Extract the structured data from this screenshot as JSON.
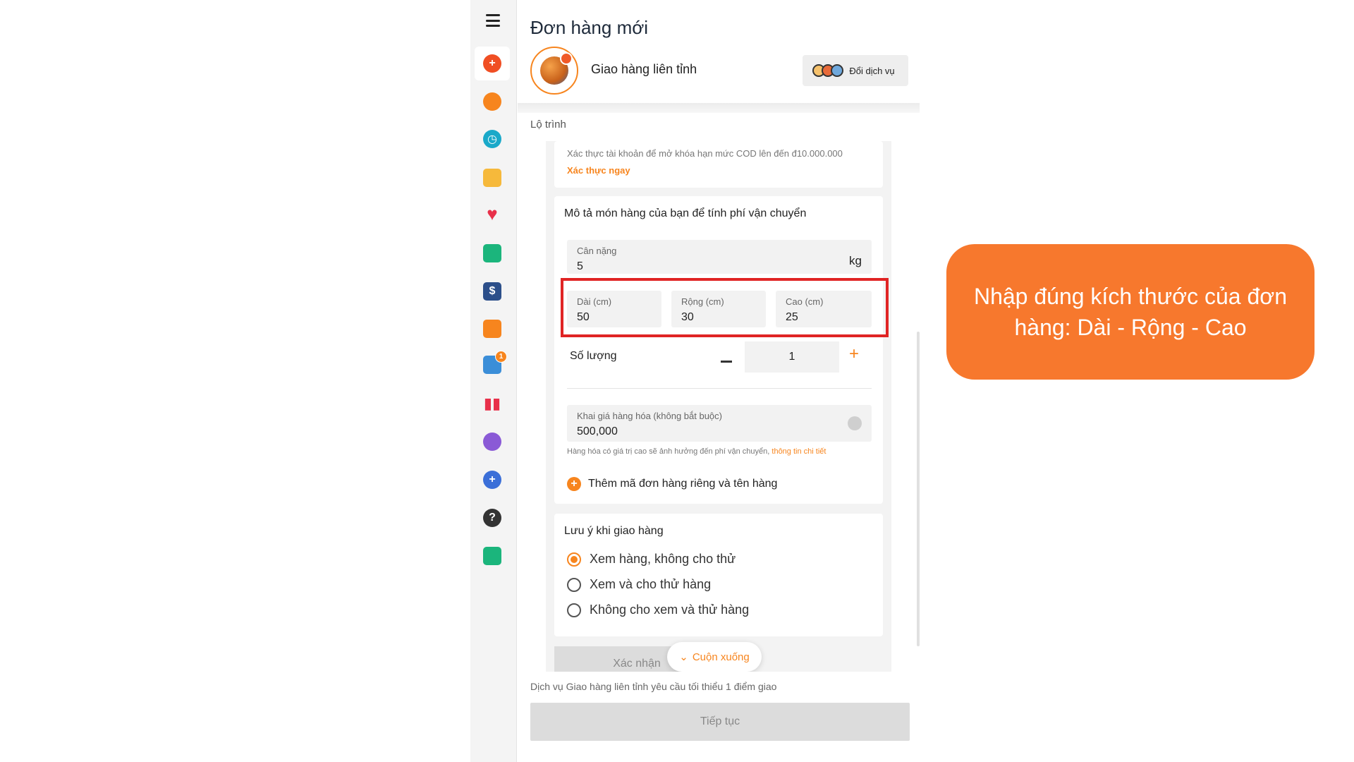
{
  "page": {
    "title": "Đơn hàng mới",
    "service_name": "Giao hàng liên tỉnh",
    "switch_service_label": "Đổi dịch vụ",
    "route_label": "Lộ trình"
  },
  "sidebar": {
    "items": [
      {
        "icon": "add-order-icon",
        "color": "#f04e23"
      },
      {
        "icon": "delivery-icon",
        "color": "#f7851e"
      },
      {
        "icon": "clock-icon",
        "color": "#1aa9c9"
      },
      {
        "icon": "folder-icon",
        "color": "#f6b93b"
      },
      {
        "icon": "heart-icon",
        "color": "#e8304a"
      },
      {
        "icon": "wallet-icon",
        "color": "#1bb57c"
      },
      {
        "icon": "money-box-icon",
        "color": "#2c4f8a"
      },
      {
        "icon": "gift-icon",
        "color": "#f7851e"
      },
      {
        "icon": "report-icon",
        "color": "#3b8ed8",
        "badge": "1"
      },
      {
        "icon": "chart-icon",
        "color": "#e8304a"
      },
      {
        "icon": "team-icon",
        "color": "#8a5ad6"
      },
      {
        "icon": "add-user-icon",
        "color": "#3b6fd8"
      },
      {
        "icon": "help-icon",
        "color": "#333333"
      },
      {
        "icon": "gift-box-icon",
        "color": "#1bb57c"
      }
    ]
  },
  "verification": {
    "text": "Xác thực tài khoản để mở khóa hạn mức COD lên đến đ10.000.000",
    "link": "Xác thực ngay"
  },
  "item_card": {
    "title": "Mô tả món hàng của bạn để tính phí vận chuyển",
    "weight": {
      "label": "Cân nặng",
      "value": "5",
      "unit": "kg"
    },
    "length": {
      "label": "Dài (cm)",
      "value": "50"
    },
    "width": {
      "label": "Rộng (cm)",
      "value": "30"
    },
    "height": {
      "label": "Cao (cm)",
      "value": "25"
    },
    "quantity": {
      "label": "Số lượng",
      "value": "1"
    },
    "declared_value": {
      "label": "Khai giá hàng hóa (không bắt buộc)",
      "value": "500,000"
    },
    "declared_note": "Hàng hóa có giá trị cao sẽ ảnh hưởng đến phí vận chuyển,",
    "declared_link": "thông tin chi tiết",
    "add_code_label": "Thêm mã đơn hàng riêng và tên hàng"
  },
  "delivery_notes": {
    "title": "Lưu ý khi giao hàng",
    "options": [
      {
        "label": "Xem hàng, không cho thử",
        "selected": true
      },
      {
        "label": "Xem và cho thử hàng",
        "selected": false
      },
      {
        "label": "Không cho xem và thử hàng",
        "selected": false
      }
    ]
  },
  "confirm_label": "Xác nhận",
  "scroll_down_label": "Cuộn xuống",
  "bottom_note": "Dịch vụ Giao hàng liên tỉnh yêu cầu tối thiểu 1 điểm giao",
  "continue_label": "Tiếp tục",
  "callout": {
    "text": "Nhập đúng kích thước của đơn hàng: Dài - Rộng - Cao",
    "color": "#f7782d"
  },
  "accent_color": "#f7851e"
}
